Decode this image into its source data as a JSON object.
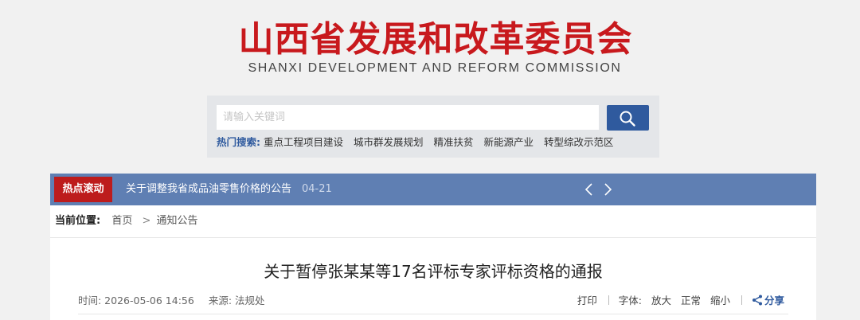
{
  "header": {
    "logo_cn": "山西省发展和改革委员会",
    "logo_en": "SHANXI DEVELOPMENT AND REFORM COMMISSION"
  },
  "search": {
    "placeholder": "请输入关键词",
    "button_icon": "search-icon",
    "hot_label": "热门搜索:",
    "hot_items": [
      "重点工程项目建设",
      "城市群发展规划",
      "精准扶贫",
      "新能源产业",
      "转型综改示范区"
    ]
  },
  "ticker": {
    "badge": "热点滚动",
    "text": "关于调整我省成品油零售价格的公告",
    "date": "04-21",
    "prev_icon": "chevron-left-icon",
    "next_icon": "chevron-right-icon"
  },
  "breadcrumb": {
    "label": "当前位置:",
    "home": "首页",
    "separator": ">",
    "current": "通知公告"
  },
  "article": {
    "title": "关于暂停张某某等17名评标专家评标资格的通报",
    "time": "时间: 2026-05-06 14:56",
    "source": "来源: 法规处"
  },
  "tools": {
    "print": "打印",
    "font_label": "字体:",
    "font_large": "放大",
    "font_normal": "正常",
    "font_small": "缩小",
    "share": "分享",
    "share_icon": "share-icon"
  },
  "colors": {
    "brand_red": "#c8191d",
    "brand_blue": "#2f5a9e",
    "ticker_bg": "#5f7fb3",
    "badge_red": "#bd1c1c"
  }
}
